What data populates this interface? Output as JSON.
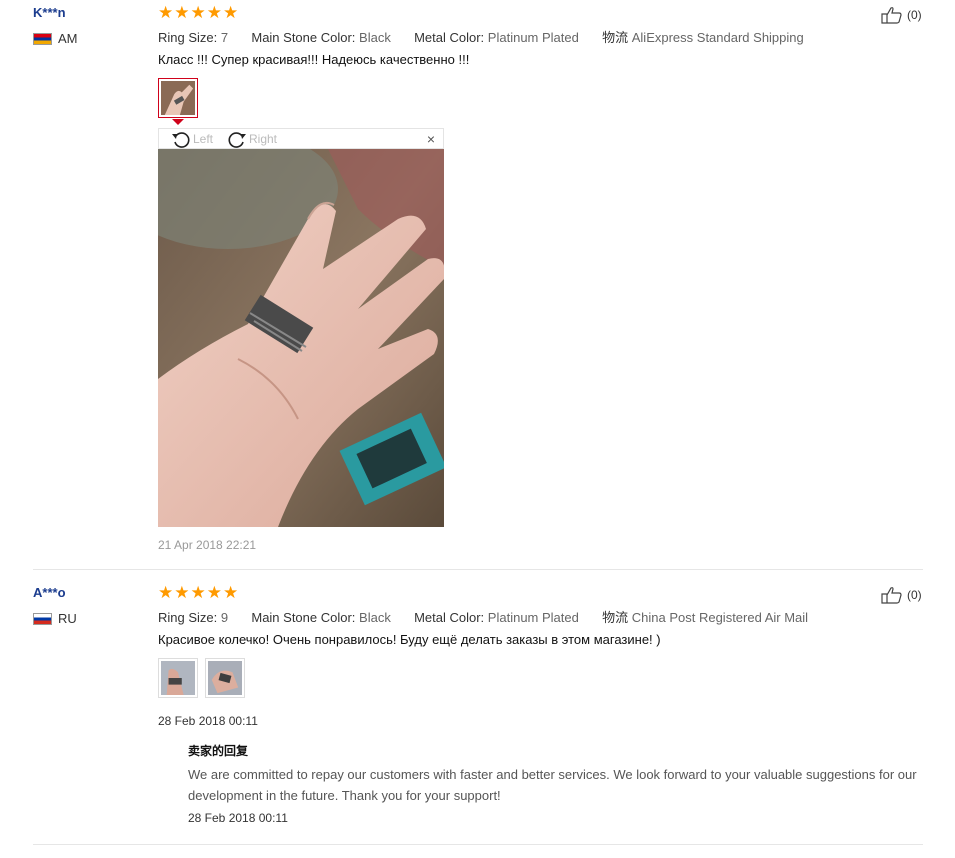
{
  "reviews": [
    {
      "user": "K***n",
      "country": "AM",
      "stars": 5,
      "attrs": [
        {
          "key": "Ring Size:",
          "value": "7"
        },
        {
          "key": "Main Stone Color:",
          "value": "Black"
        },
        {
          "key": "Metal Color:",
          "value": "Platinum Plated"
        },
        {
          "key": "物流",
          "value": "AliExpress Standard Shipping"
        }
      ],
      "text": "Класс !!! Супер красивая!!! Надеюсь качественно !!!",
      "likes": "(0)",
      "viewer": {
        "left": "Left",
        "right": "Right",
        "close": "×"
      },
      "date": "21 Apr 2018 22:21"
    },
    {
      "user": "A***o",
      "country": "RU",
      "stars": 5,
      "attrs": [
        {
          "key": "Ring Size:",
          "value": "9"
        },
        {
          "key": "Main Stone Color:",
          "value": "Black"
        },
        {
          "key": "Metal Color:",
          "value": "Platinum Plated"
        },
        {
          "key": "物流",
          "value": "China Post Registered Air Mail"
        }
      ],
      "text": "Красивое колечко! Очень понравилось! Буду ещё делать заказы в этом магазине! )",
      "likes": "(0)",
      "date": "28 Feb 2018 00:11",
      "reply": {
        "title": "卖家的回复",
        "text": "We are committed to repay our customers with faster and better services. We look forward to your valuable suggestions for our development in the future. Thank you for your support!",
        "date": "28 Feb 2018 00:11"
      }
    }
  ],
  "colors": {
    "star": "#ff9a00",
    "username": "#1b3c8e",
    "selected": "#d0021b"
  }
}
